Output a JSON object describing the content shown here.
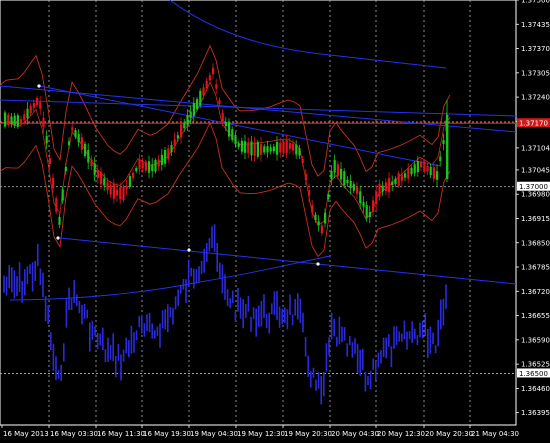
{
  "chart_data": {
    "type": "candlestick",
    "grid": true,
    "y_axis": {
      "min": 1.36362,
      "max": 1.375,
      "ticks": [
        "1.37500",
        "1.37435",
        "1.37370",
        "1.37305",
        "1.37240",
        "1.37175",
        "1.37104",
        "1.37045",
        "1.36980",
        "1.36915",
        "1.36850",
        "1.36785",
        "1.36720",
        "1.36655",
        "1.36590",
        "1.36525",
        "1.36460",
        "1.36395"
      ],
      "highlight_labels": [
        {
          "id": "price-label-current",
          "text": "1.37170",
          "value": 1.3717
        },
        {
          "id": "level-label-upper",
          "text": "1.37000",
          "value": 1.37
        },
        {
          "id": "level-label-lower",
          "text": "1.36500",
          "value": 1.365
        }
      ]
    },
    "x_axis": {
      "ticks": [
        "16 May 2013",
        "16 May 03:30",
        "16 May 11:30",
        "16 May 19:30",
        "19 May 04:30",
        "19 May 12:30",
        "19 May 20:30",
        "20 May 04:30",
        "20 May 12:30",
        "20 May 20:30",
        "21 May 04:30"
      ]
    },
    "horizontal_levels": [
      {
        "name": "current-price",
        "value": 1.3717,
        "color": "#d11a1a",
        "style": "solid"
      },
      {
        "name": "level-1.37000",
        "value": 1.37,
        "color": "#bbbbbb",
        "style": "dashed"
      },
      {
        "name": "level-1.36500",
        "value": 1.365,
        "color": "#bbbbbb",
        "style": "dashed"
      }
    ],
    "colors": {
      "bull": "#1ec41e",
      "bear": "#e0141c",
      "indicator": "#2a2ad8",
      "envelope": "#c8301a",
      "trend": "#2233ee",
      "grid": "#c8c8c8"
    }
  }
}
